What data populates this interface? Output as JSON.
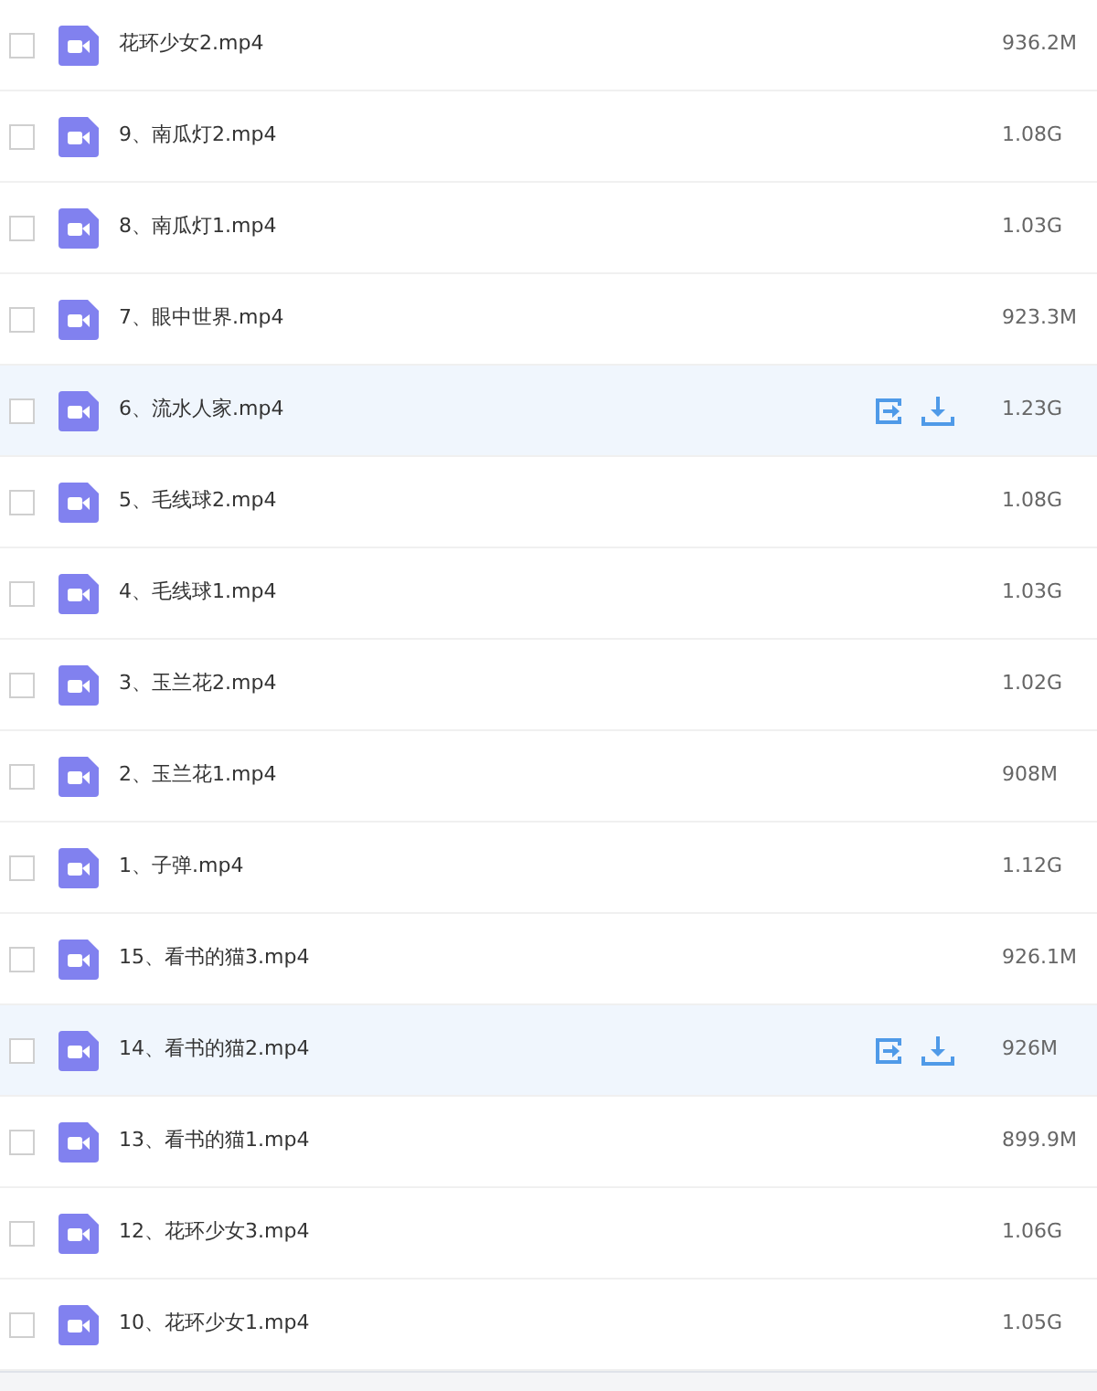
{
  "files": [
    {
      "name": "花环少女2.mp4",
      "size": "936.2M",
      "hovered": false,
      "checked": false
    },
    {
      "name": "9、南瓜灯2.mp4",
      "size": "1.08G",
      "hovered": false,
      "checked": false
    },
    {
      "name": "8、南瓜灯1.mp4",
      "size": "1.03G",
      "hovered": false,
      "checked": false
    },
    {
      "name": "7、眼中世界.mp4",
      "size": "923.3M",
      "hovered": false,
      "checked": false
    },
    {
      "name": "6、流水人家.mp4",
      "size": "1.23G",
      "hovered": true,
      "checked": false
    },
    {
      "name": "5、毛线球2.mp4",
      "size": "1.08G",
      "hovered": false,
      "checked": false
    },
    {
      "name": "4、毛线球1.mp4",
      "size": "1.03G",
      "hovered": false,
      "checked": false
    },
    {
      "name": "3、玉兰花2.mp4",
      "size": "1.02G",
      "hovered": false,
      "checked": false
    },
    {
      "name": "2、玉兰花1.mp4",
      "size": "908M",
      "hovered": false,
      "checked": false
    },
    {
      "name": "1、子弹.mp4",
      "size": "1.12G",
      "hovered": false,
      "checked": false
    },
    {
      "name": "15、看书的猫3.mp4",
      "size": "926.1M",
      "hovered": false,
      "checked": false
    },
    {
      "name": "14、看书的猫2.mp4",
      "size": "926M",
      "hovered": true,
      "checked": false
    },
    {
      "name": "13、看书的猫1.mp4",
      "size": "899.9M",
      "hovered": false,
      "checked": false
    },
    {
      "name": "12、花环少女3.mp4",
      "size": "1.06G",
      "hovered": false,
      "checked": false
    },
    {
      "name": "10、花环少女1.mp4",
      "size": "1.05G",
      "hovered": false,
      "checked": false
    }
  ]
}
